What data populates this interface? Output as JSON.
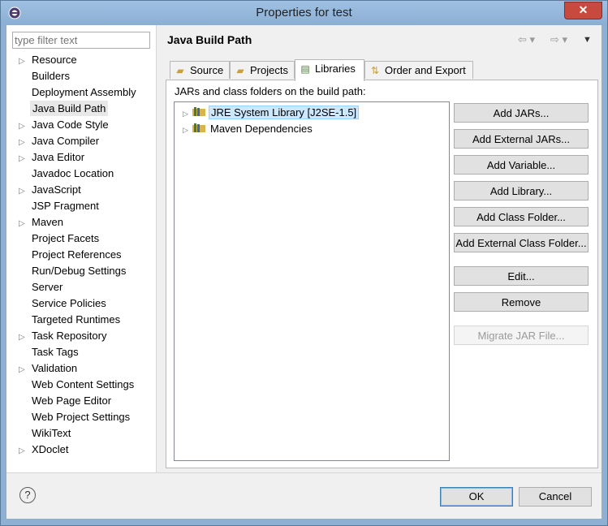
{
  "window": {
    "title": "Properties for test",
    "close_glyph": "✕"
  },
  "filter": {
    "placeholder": "type filter text"
  },
  "tree": [
    {
      "label": "Resource",
      "expandable": true
    },
    {
      "label": "Builders",
      "expandable": false
    },
    {
      "label": "Deployment Assembly",
      "expandable": false
    },
    {
      "label": "Java Build Path",
      "expandable": false,
      "selected": true
    },
    {
      "label": "Java Code Style",
      "expandable": true
    },
    {
      "label": "Java Compiler",
      "expandable": true
    },
    {
      "label": "Java Editor",
      "expandable": true
    },
    {
      "label": "Javadoc Location",
      "expandable": false
    },
    {
      "label": "JavaScript",
      "expandable": true
    },
    {
      "label": "JSP Fragment",
      "expandable": false
    },
    {
      "label": "Maven",
      "expandable": true
    },
    {
      "label": "Project Facets",
      "expandable": false
    },
    {
      "label": "Project References",
      "expandable": false
    },
    {
      "label": "Run/Debug Settings",
      "expandable": false
    },
    {
      "label": "Server",
      "expandable": false
    },
    {
      "label": "Service Policies",
      "expandable": false
    },
    {
      "label": "Targeted Runtimes",
      "expandable": false
    },
    {
      "label": "Task Repository",
      "expandable": true
    },
    {
      "label": "Task Tags",
      "expandable": false
    },
    {
      "label": "Validation",
      "expandable": true
    },
    {
      "label": "Web Content Settings",
      "expandable": false
    },
    {
      "label": "Web Page Editor",
      "expandable": false
    },
    {
      "label": "Web Project Settings",
      "expandable": false
    },
    {
      "label": "WikiText",
      "expandable": false
    },
    {
      "label": "XDoclet",
      "expandable": true
    }
  ],
  "page": {
    "title": "Java Build Path"
  },
  "tabs": [
    {
      "label": "Source",
      "icon": "source-folder-icon"
    },
    {
      "label": "Projects",
      "icon": "projects-icon"
    },
    {
      "label": "Libraries",
      "icon": "libraries-icon",
      "active": true
    },
    {
      "label": "Order and Export",
      "icon": "order-export-icon"
    }
  ],
  "libraries": {
    "caption": "JARs and class folders on the build path:",
    "items": [
      {
        "label": "JRE System Library [J2SE-1.5]",
        "selected": true
      },
      {
        "label": "Maven Dependencies",
        "selected": false
      }
    ]
  },
  "buttons": {
    "add_jars": "Add JARs...",
    "add_external_jars": "Add External JARs...",
    "add_variable": "Add Variable...",
    "add_library": "Add Library...",
    "add_class_folder": "Add Class Folder...",
    "add_external_class_folder": "Add External Class Folder...",
    "edit": "Edit...",
    "remove": "Remove",
    "migrate_jar": "Migrate JAR File..."
  },
  "dialog": {
    "ok": "OK",
    "cancel": "Cancel",
    "help_glyph": "?"
  },
  "colors": {
    "accent": "#3c7fb1",
    "selection": "#cce8ff",
    "titlebar": "#8eb0d3",
    "close": "#c74a3f"
  }
}
